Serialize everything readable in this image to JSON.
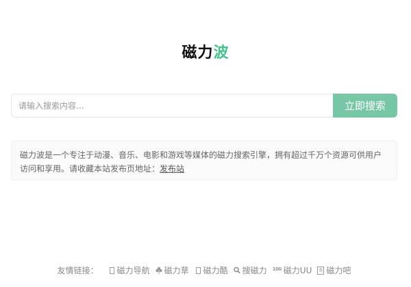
{
  "logo": {
    "part1": "磁力",
    "part2": "波"
  },
  "search": {
    "placeholder": "请输入搜索内容...",
    "button_label": "立即搜索"
  },
  "intro": {
    "text": "磁力波是一个专注于动漫、音乐、电影和游戏等媒体的磁力搜索引擎，拥有超过千万个资源可供用户访问和享用。请收藏本站发布页地址：",
    "link_label": "发布站"
  },
  "footer": {
    "label": "友情链接：",
    "links": [
      {
        "icon": "box-icon",
        "label": "磁力导航"
      },
      {
        "icon": "clover-icon",
        "label": "磁力草"
      },
      {
        "icon": "box-icon",
        "label": "磁力酷"
      },
      {
        "icon": "search-icon",
        "label": "搜磁力"
      },
      {
        "icon": "100-icon",
        "icon_text": "100",
        "label": "磁力UU"
      },
      {
        "icon": "number-8-icon",
        "icon_text": "8",
        "label": "磁力吧"
      }
    ]
  },
  "colors": {
    "accent": "#45c38f",
    "button": "#77c6a6"
  }
}
